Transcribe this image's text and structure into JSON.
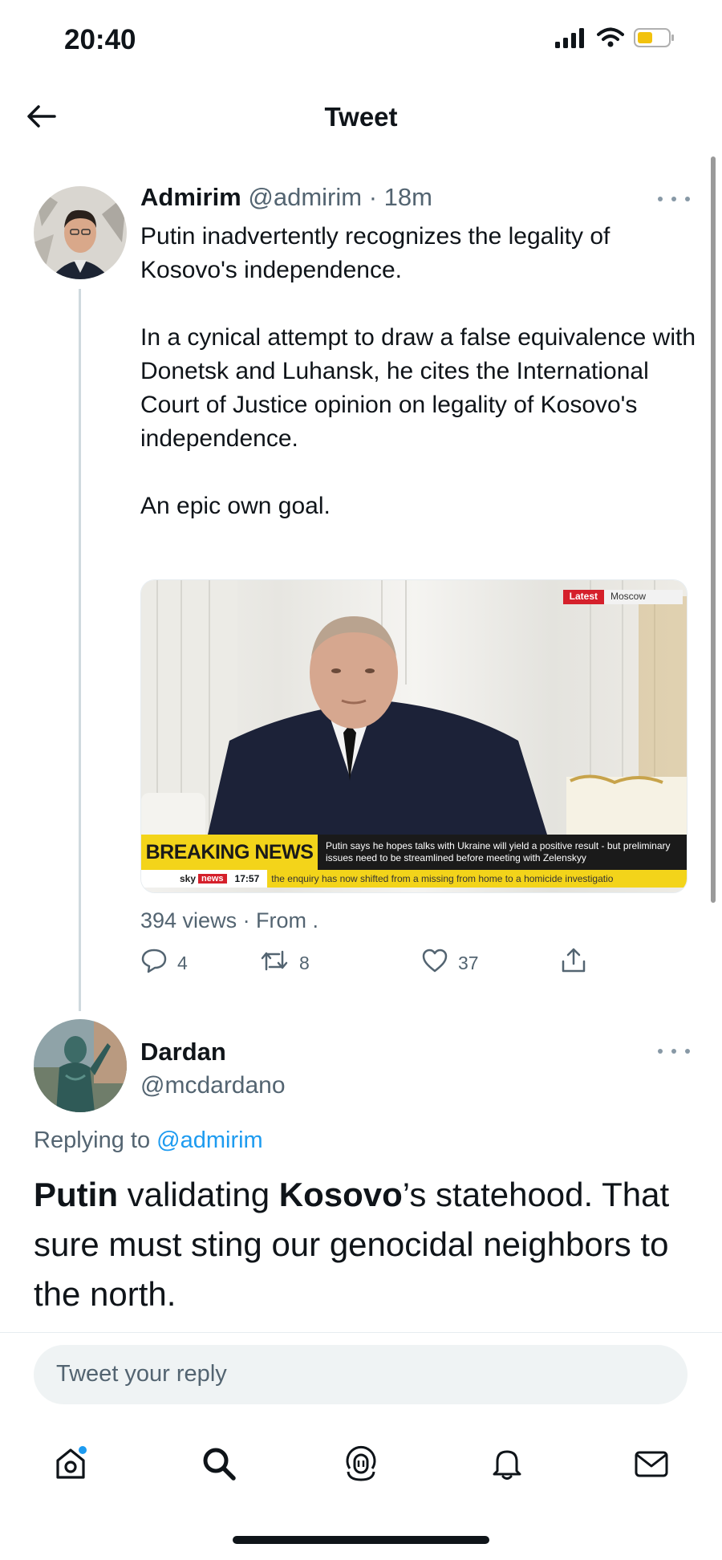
{
  "status_bar": {
    "time": "20:40"
  },
  "header": {
    "title": "Tweet"
  },
  "tweet": {
    "author_name": "Admirim",
    "author_handle": "@admirim",
    "separator": "·",
    "time_ago": "18m",
    "paragraphs": [
      "Putin inadvertently recognizes the legality of Kosovo's independence.",
      "In a cynical attempt to draw a false equivalence with Donetsk and Luhansk, he cites the International Court of Justice opinion on legality of Kosovo's independence.",
      "An epic own goal."
    ],
    "media": {
      "latest_tag": "Latest",
      "location_tag": "Moscow",
      "breaking_label": "BREAKING NEWS",
      "breaking_text": "Putin says he hopes talks with Ukraine will yield a positive result - but preliminary issues need to be streamlined before meeting with Zelenskyy",
      "channel_sky": "sky",
      "channel_news": "news",
      "ticker_time": "17:57",
      "ticker_text": "the enquiry has now shifted from a missing from home to a homicide investigatio"
    },
    "views_text": "394 views · From .",
    "reply_count": "4",
    "retweet_count": "8",
    "like_count": "37"
  },
  "reply": {
    "author_name": "Dardan",
    "author_handle": "@mcdardano",
    "replying_prefix": "Replying to",
    "replying_handle": "@admirim",
    "text_parts": [
      "Putin",
      " validating ",
      "Kosovo",
      "’s statehood. That sure must sting our genocidal neighbors to the north."
    ]
  },
  "composer": {
    "placeholder": "Tweet your reply"
  },
  "colors": {
    "accent": "#1d9bf0",
    "muted": "#536471",
    "breaking_yellow": "#f3d41a",
    "news_red": "#d5202b"
  },
  "icons": [
    "back-arrow-icon",
    "signal-icon",
    "wifi-icon",
    "battery-icon",
    "more-icon",
    "reply-icon",
    "retweet-icon",
    "like-icon",
    "share-icon",
    "home-icon",
    "search-icon",
    "spaces-icon",
    "notifications-icon",
    "messages-icon"
  ]
}
